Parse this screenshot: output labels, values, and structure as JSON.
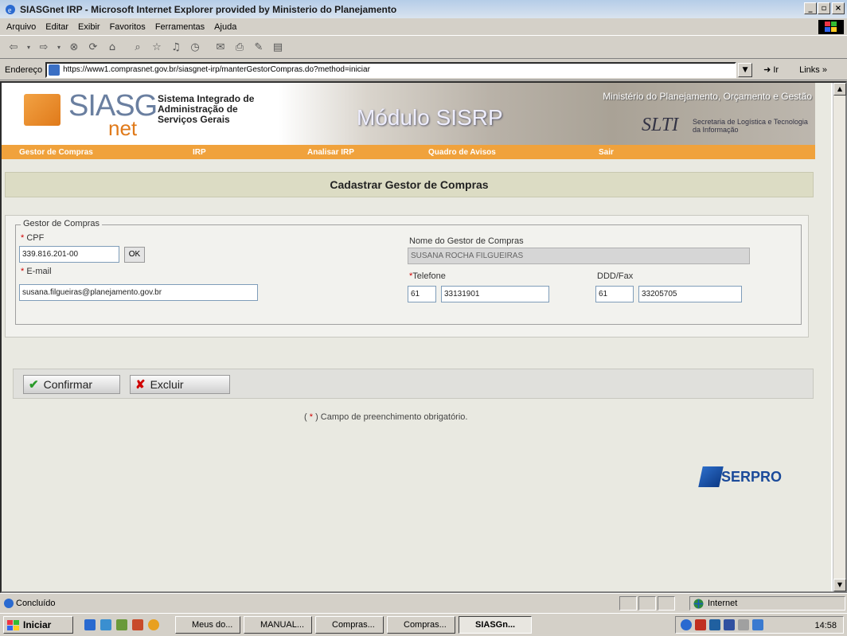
{
  "window": {
    "title": "SIASGnet IRP - Microsoft Internet Explorer provided by Ministerio do Planejamento"
  },
  "menu": [
    "Arquivo",
    "Editar",
    "Exibir",
    "Favoritos",
    "Ferramentas",
    "Ajuda"
  ],
  "address": {
    "label": "Endereço",
    "url": "https://www1.comprasnet.gov.br/siasgnet-irp/manterGestorCompras.do?method=iniciar",
    "go": "Ir",
    "links": "Links »"
  },
  "banner": {
    "logo": "SIASG",
    "logo_suffix": "net",
    "system_name": "Sistema Integrado de Administração de Serviços Gerais",
    "module": "Módulo SISRP",
    "ministry": "Ministério do Planejamento, Orçamento e Gestão",
    "slti": "SLTI",
    "slti_name": "Secretaria de Logística e Tecnologia da Informação"
  },
  "nav": [
    "Gestor de Compras",
    "IRP",
    "Analisar IRP",
    "Quadro de Avisos",
    "Sair"
  ],
  "page_title": "Cadastrar Gestor de Compras",
  "form": {
    "legend": "Gestor de Compras",
    "req_marker": "*",
    "cpf_label": "CPF",
    "cpf_value": "339.816.201-00",
    "ok_label": "OK",
    "nome_label": "Nome do Gestor de Compras",
    "nome_value": "SUSANA ROCHA FILGUEIRAS",
    "email_label": "E-mail",
    "email_value": "susana.filgueiras@planejamento.gov.br",
    "telefone_label": "Telefone",
    "telefone_ddd": "61",
    "telefone_num": "33131901",
    "fax_label": "DDD/Fax",
    "fax_ddd": "61",
    "fax_num": "33205705"
  },
  "actions": {
    "confirm": "Confirmar",
    "delete": "Excluir"
  },
  "note_prefix": "(",
  "note_marker": "*",
  "note_text": ") Campo de preenchimento obrigatório.",
  "footer_logo": "SERPRO",
  "status": {
    "text": "Concluído",
    "zone": "Internet"
  },
  "taskbar": {
    "start": "Iniciar",
    "tasks": [
      "Meus do...",
      "MANUAL...",
      "Compras...",
      "Compras...",
      "SIASGn..."
    ],
    "clock": "14:58"
  },
  "colors": {
    "nav": "#f0a23c",
    "required": "#d00000",
    "confirm_icon": "#2a9a2a",
    "delete_icon": "#d00000"
  }
}
